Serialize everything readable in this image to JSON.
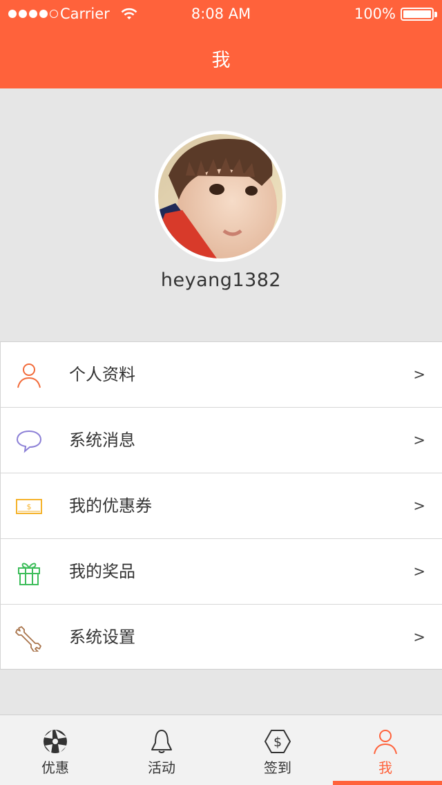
{
  "status_bar": {
    "carrier": "Carrier",
    "time": "8:08 AM",
    "battery": "100%"
  },
  "nav": {
    "title": "我"
  },
  "profile": {
    "username": "heyang1382"
  },
  "menu": {
    "items": [
      {
        "label": "个人资料",
        "arrow": ">",
        "icon": "person-icon",
        "color": "#f26b3a"
      },
      {
        "label": "系统消息",
        "arrow": ">",
        "icon": "chat-bubble-icon",
        "color": "#8b7fd6"
      },
      {
        "label": "我的优惠券",
        "arrow": ">",
        "icon": "coupon-icon",
        "color": "#f5b22a"
      },
      {
        "label": "我的奖品",
        "arrow": ">",
        "icon": "gift-icon",
        "color": "#3dbd5a"
      },
      {
        "label": "系统设置",
        "arrow": ">",
        "icon": "wrench-icon",
        "color": "#a8734a"
      }
    ]
  },
  "tabbar": {
    "tabs": [
      {
        "label": "优惠",
        "icon": "aperture-icon",
        "active": false
      },
      {
        "label": "活动",
        "icon": "bell-icon",
        "active": false
      },
      {
        "label": "签到",
        "icon": "dollar-hexagon-icon",
        "active": false
      },
      {
        "label": "我",
        "icon": "person-icon",
        "active": true
      }
    ]
  },
  "colors": {
    "accent": "#ff623b",
    "background": "#e6e6e6"
  }
}
